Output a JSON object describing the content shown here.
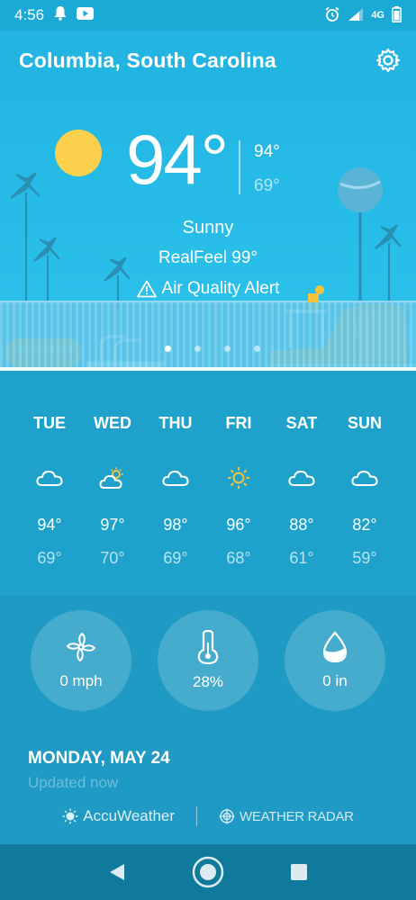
{
  "status_bar": {
    "time": "4:56",
    "network": "4G"
  },
  "location": "Columbia, South Carolina",
  "current": {
    "temperature": "94°",
    "high": "94°",
    "low": "69°",
    "condition": "Sunny",
    "realfeel": "RealFeel 99°",
    "alert": "Air Quality Alert"
  },
  "pager": {
    "count": 4,
    "active": 1
  },
  "forecast": [
    {
      "day": "TUE",
      "icon": "cloud-icon",
      "high": "94°",
      "low": "69°"
    },
    {
      "day": "WED",
      "icon": "partly-sunny-icon",
      "high": "97°",
      "low": "70°"
    },
    {
      "day": "THU",
      "icon": "cloud-icon",
      "high": "98°",
      "low": "69°"
    },
    {
      "day": "FRI",
      "icon": "sun-icon",
      "high": "96°",
      "low": "68°"
    },
    {
      "day": "SAT",
      "icon": "cloud-icon",
      "high": "88°",
      "low": "61°"
    },
    {
      "day": "SUN",
      "icon": "cloud-icon",
      "high": "82°",
      "low": "59°"
    }
  ],
  "metrics": [
    {
      "icon": "wind-icon",
      "value": "0 mph"
    },
    {
      "icon": "humidity-icon",
      "value": "28%"
    },
    {
      "icon": "precipitation-icon",
      "value": "0 in"
    }
  ],
  "date": "MONDAY, MAY 24",
  "updated": "Updated now",
  "footer": {
    "brand": "AccuWeather",
    "radar": "WEATHER RADAR"
  },
  "colors": {
    "sun": "#fbd04d",
    "sky": "#22b3e1",
    "forecast_bg": "#1ea2cc",
    "nav_bg": "#107a9d"
  }
}
